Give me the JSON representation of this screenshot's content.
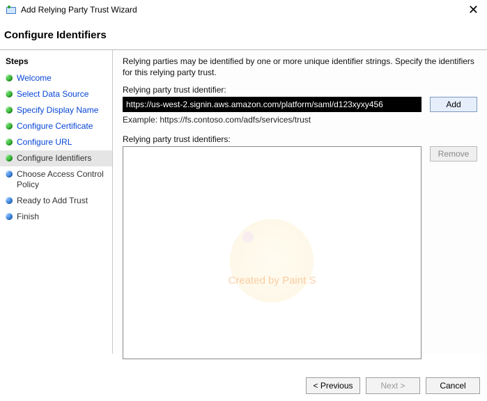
{
  "window": {
    "title": "Add Relying Party Trust Wizard",
    "close_glyph": "✕"
  },
  "heading": "Configure Identifiers",
  "sidebar": {
    "title": "Steps",
    "items": [
      {
        "label": "Welcome",
        "state": "done",
        "link": true
      },
      {
        "label": "Select Data Source",
        "state": "done",
        "link": true
      },
      {
        "label": "Specify Display Name",
        "state": "done",
        "link": true
      },
      {
        "label": "Configure Certificate",
        "state": "done",
        "link": true
      },
      {
        "label": "Configure URL",
        "state": "done",
        "link": true
      },
      {
        "label": "Configure Identifiers",
        "state": "done",
        "selected": true
      },
      {
        "label": "Choose Access Control Policy",
        "state": "pending"
      },
      {
        "label": "Ready to Add Trust",
        "state": "pending"
      },
      {
        "label": "Finish",
        "state": "pending"
      }
    ]
  },
  "main": {
    "instructions": "Relying parties may be identified by one or more unique identifier strings. Specify the identifiers for this relying party trust.",
    "identifier_label": "Relying party trust identifier:",
    "identifier_value": "https://us-west-2.signin.aws.amazon.com/platform/saml/d123xyxy456",
    "example_text": "Example: https://fs.contoso.com/adfs/services/trust",
    "identifiers_list_label": "Relying party trust identifiers:",
    "add_button": "Add",
    "remove_button": "Remove",
    "watermark_text": "Created by Paint S"
  },
  "footer": {
    "previous": "< Previous",
    "next": "Next >",
    "cancel": "Cancel"
  }
}
